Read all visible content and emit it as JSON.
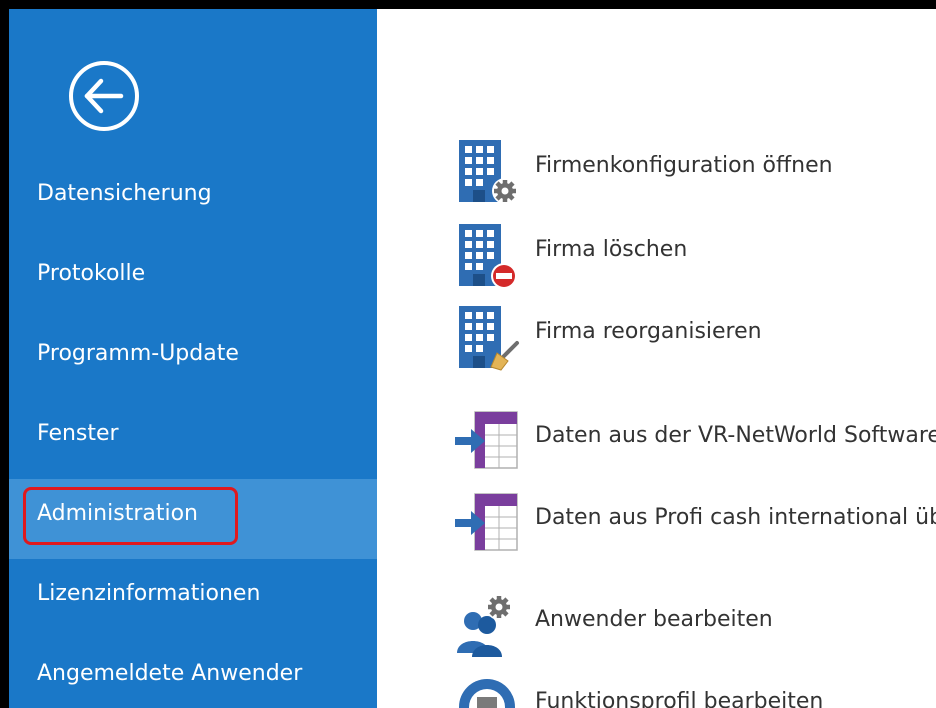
{
  "sidebar": {
    "back": {
      "icon": "back-arrow-circle-icon"
    },
    "items": [
      {
        "label": "Datensicherung"
      },
      {
        "label": "Protokolle"
      },
      {
        "label": "Programm-Update"
      },
      {
        "label": "Fenster"
      },
      {
        "label": "Administration",
        "selected": true
      },
      {
        "label": "Lizenzinformationen"
      },
      {
        "label": "Angemeldete Anwender"
      }
    ]
  },
  "main": {
    "actions": [
      {
        "label": "Firmenkonfiguration öffnen",
        "icon": "building-gear-icon"
      },
      {
        "label": "Firma löschen",
        "icon": "building-delete-icon"
      },
      {
        "label": "Firma reorganisieren",
        "icon": "building-brush-icon"
      },
      {
        "label": "Daten aus der VR-NetWorld Software",
        "icon": "import-table-icon"
      },
      {
        "label": "Daten aus Profi cash international üb",
        "icon": "import-table-icon"
      },
      {
        "label": "Anwender bearbeiten",
        "icon": "users-gear-icon"
      },
      {
        "label": "Funktionsprofil bearbeiten",
        "icon": "profile-gear-icon"
      }
    ]
  },
  "colors": {
    "sidebar_bg": "#1a78c8",
    "selected_item_bg": "#3f92d6",
    "highlight_border": "#e0191e",
    "icon_blue": "#2f6db3",
    "icon_purple": "#7a3e9d",
    "text": "#333333"
  }
}
